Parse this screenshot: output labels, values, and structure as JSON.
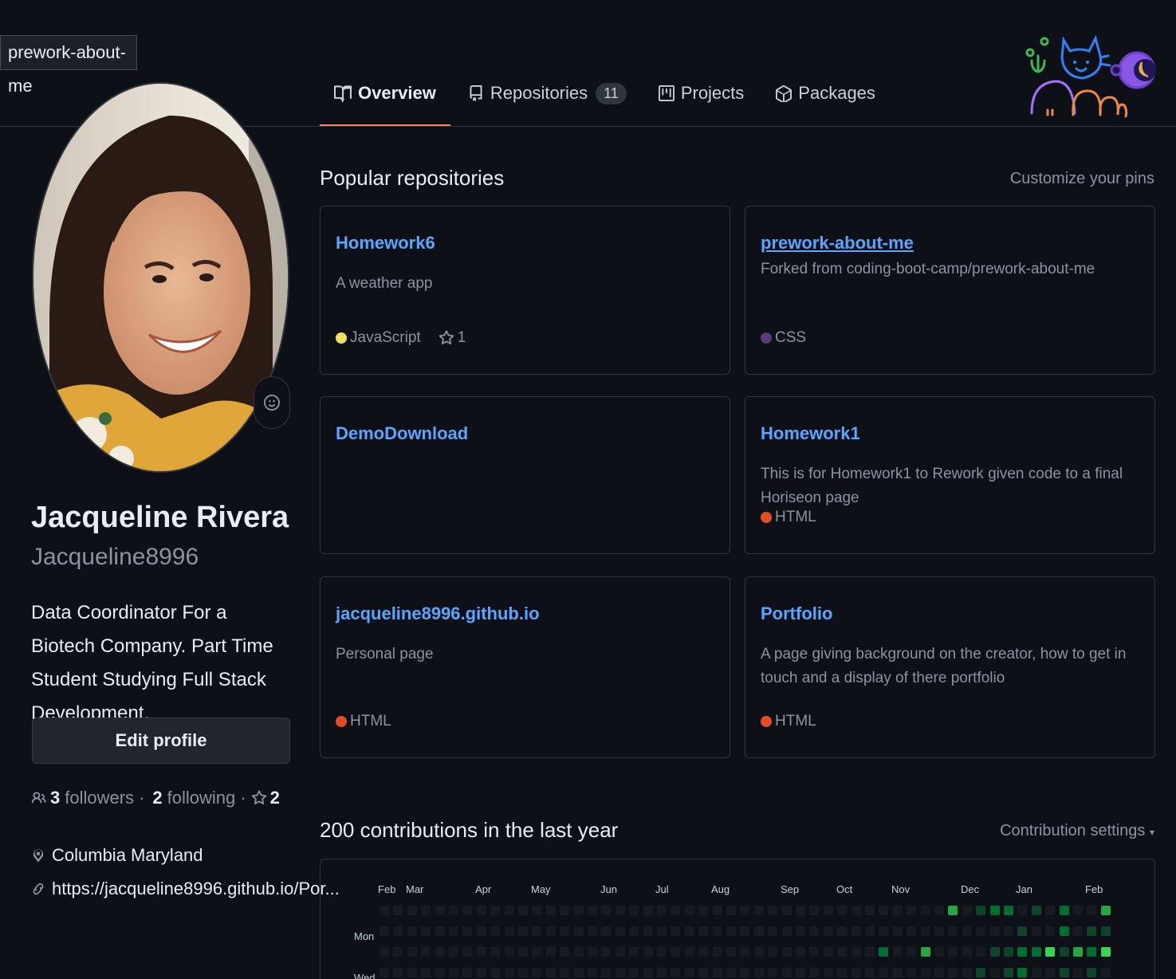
{
  "tooltip": "prework-about-me",
  "tabs": [
    {
      "label": "Overview",
      "active": true
    },
    {
      "label": "Repositories",
      "count": "11"
    },
    {
      "label": "Projects"
    },
    {
      "label": "Packages"
    }
  ],
  "profile": {
    "name": "Jacqueline Rivera",
    "username": "Jacqueline8996",
    "bio": "Data Coordinator For a Biotech Company. Part Time Student Studying Full Stack Development.",
    "edit_label": "Edit profile",
    "followers_count": "3",
    "followers_label": "followers",
    "following_count": "2",
    "following_label": "following",
    "stars_count": "2",
    "location": "Columbia Maryland",
    "website": "https://jacqueline8996.github.io/Por..."
  },
  "pinned": {
    "title": "Popular repositories",
    "customize": "Customize your pins",
    "repos": [
      {
        "name": "Homework6",
        "description": "A weather app",
        "language": "JavaScript",
        "color": "#f1e05a",
        "stars": "1"
      },
      {
        "name": "prework-about-me",
        "forked_from": "Forked from coding-boot-camp/prework-about-me",
        "language": "CSS",
        "color": "#563d7c"
      },
      {
        "name": "DemoDownload"
      },
      {
        "name": "Homework1",
        "description": "This is for Homework1 to Rework given code to a final Horiseon page",
        "language": "HTML",
        "color": "#e34c26"
      },
      {
        "name": "jacqueline8996.github.io",
        "description": "Personal page",
        "language": "HTML",
        "color": "#e34c26"
      },
      {
        "name": "Portfolio",
        "description": "A page giving background on the creator, how to get in touch and a display of there portfolio",
        "language": "HTML",
        "color": "#e34c26"
      }
    ]
  },
  "contributions": {
    "title": "200 contributions in the last year",
    "settings": "Contribution settings",
    "months": [
      "Feb",
      "Mar",
      "Apr",
      "May",
      "Jun",
      "Jul",
      "Aug",
      "Sep",
      "Oct",
      "Nov",
      "Dec",
      "Jan",
      "Feb"
    ],
    "days": [
      "Mon",
      "Wed"
    ]
  },
  "colors": {
    "accent": "#f78166",
    "link": "#58a6ff",
    "level1": "#0e4429",
    "level2": "#006d32",
    "level3": "#26a641",
    "level4": "#39d353"
  }
}
